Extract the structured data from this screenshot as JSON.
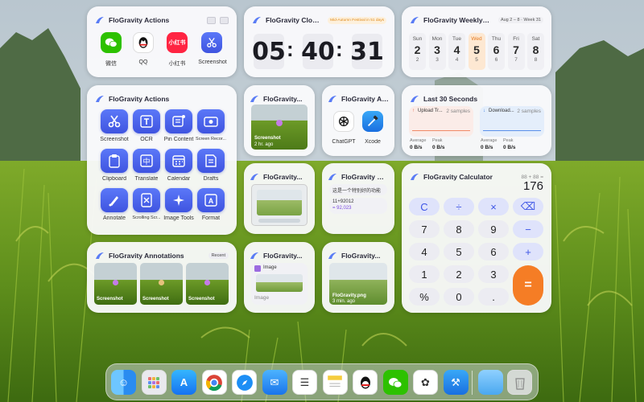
{
  "colors": {
    "accent": "#4a63f0",
    "orange": "#f57d25",
    "blue_card": "#e7effc",
    "red_card": "#fbecea"
  },
  "actions_top": {
    "title": "FloGravity Actions",
    "apps": [
      {
        "label": "微信",
        "icon": "wechat-icon"
      },
      {
        "label": "QQ",
        "icon": "qq-icon"
      },
      {
        "label": "小红书",
        "icon": "xiaohongshu-icon"
      },
      {
        "label": "Screenshot",
        "icon": "screenshot-icon"
      }
    ]
  },
  "clock": {
    "title": "FloGravity Clock",
    "event": "Mid-Autumn Festival in 51 days",
    "h": "05",
    "m": "40",
    "s": "31"
  },
  "calendar": {
    "title": "FloGravity Weekly Calendar",
    "range": "Aug 2 – 8 · Week 31",
    "days": [
      {
        "name": "Sun",
        "date": "2",
        "lunar": "2"
      },
      {
        "name": "Mon",
        "date": "3",
        "lunar": "3"
      },
      {
        "name": "Tue",
        "date": "4",
        "lunar": "4"
      },
      {
        "name": "Wed",
        "date": "5",
        "lunar": "5"
      },
      {
        "name": "Thu",
        "date": "6",
        "lunar": "6"
      },
      {
        "name": "Fri",
        "date": "7",
        "lunar": "7"
      },
      {
        "name": "Sat",
        "date": "8",
        "lunar": "8"
      }
    ],
    "today_index": 3
  },
  "actions_grid": {
    "title": "FloGravity Actions",
    "items": [
      {
        "label": "Screenshot",
        "icon": "scissors-icon"
      },
      {
        "label": "OCR",
        "icon": "ocr-text-icon"
      },
      {
        "label": "Pin Content",
        "icon": "pin-content-icon"
      },
      {
        "label": "Screen Recor...",
        "icon": "screen-record-icon"
      },
      {
        "label": "Clipboard",
        "icon": "clipboard-icon"
      },
      {
        "label": "Translate",
        "icon": "translate-icon"
      },
      {
        "label": "Calendar",
        "icon": "calendar-icon"
      },
      {
        "label": "Drafts",
        "icon": "drafts-icon"
      },
      {
        "label": "Annotate",
        "icon": "annotate-brush-icon"
      },
      {
        "label": "Scrolling Scr...",
        "icon": "scrolling-screenshot-icon"
      },
      {
        "label": "Image Tools",
        "icon": "image-tools-icon"
      },
      {
        "label": "Format",
        "icon": "format-icon"
      }
    ]
  },
  "shot_widget": {
    "title": "FloGravity...",
    "caption": "Screenshot",
    "time": "2 hr. ago"
  },
  "ai_actions": {
    "title": "FloGravity Ac...",
    "items": [
      {
        "label": "ChatGPT",
        "icon": "chatgpt-icon"
      },
      {
        "label": "Xcode",
        "icon": "xcode-icon"
      }
    ]
  },
  "network": {
    "title": "Last 30 Seconds",
    "upload": {
      "label": "Upload Tr...",
      "samples": "2 samples",
      "avg_label": "Average",
      "avg": "0 B/s",
      "peak_label": "Peak",
      "peak": "0 B/s"
    },
    "download": {
      "label": "Download...",
      "samples": "2 samples",
      "avg_label": "Average",
      "avg": "0 B/s",
      "peak_label": "Peak",
      "peak": "0 B/s"
    }
  },
  "pin_widget": {
    "title": "FloGravity..."
  },
  "drafts": {
    "title": "FloGravity Drafts",
    "note1": "这是一个特别好的功能",
    "note2_expr": "11+92012",
    "note2_result": "= 92,023"
  },
  "calculator": {
    "title": "FloGravity Calculator",
    "expr": "88 + 88 =",
    "display": "176",
    "keys": [
      [
        "C",
        "÷",
        "×",
        "⌫"
      ],
      [
        "7",
        "8",
        "9",
        "−"
      ],
      [
        "4",
        "5",
        "6",
        "+"
      ],
      [
        "1",
        "2",
        "3",
        ""
      ],
      [
        "%",
        "0",
        ".",
        ""
      ]
    ],
    "equals": "="
  },
  "annotations": {
    "title": "FloGravity Annotations",
    "badge": "Recent",
    "items": [
      {
        "label": "Screenshot"
      },
      {
        "label": "Screenshot"
      },
      {
        "label": "Screenshot"
      }
    ]
  },
  "pasted": {
    "title": "FloGravity...",
    "type": "Image",
    "footer": "Image"
  },
  "file_widget": {
    "title": "FloGravity...",
    "filename": "FloGravity.png",
    "time": "3 min. ago"
  },
  "dock": {
    "items": [
      {
        "name": "finder",
        "icon": "finder-icon"
      },
      {
        "name": "launchpad",
        "icon": "launchpad-icon"
      },
      {
        "name": "app-store",
        "icon": "app-store-icon"
      },
      {
        "name": "chrome",
        "icon": "chrome-icon"
      },
      {
        "name": "safari",
        "icon": "safari-icon"
      },
      {
        "name": "mail",
        "icon": "mail-icon"
      },
      {
        "name": "reminders",
        "icon": "reminders-icon"
      },
      {
        "name": "notes",
        "icon": "notes-icon"
      },
      {
        "name": "qq",
        "icon": "qq-icon"
      },
      {
        "name": "wechat",
        "icon": "wechat-icon"
      },
      {
        "name": "chatgpt",
        "icon": "chatgpt-icon"
      },
      {
        "name": "xcode",
        "icon": "xcode-icon"
      },
      {
        "name": "folder",
        "icon": "folder-icon"
      },
      {
        "name": "trash",
        "icon": "trash-icon"
      }
    ]
  }
}
